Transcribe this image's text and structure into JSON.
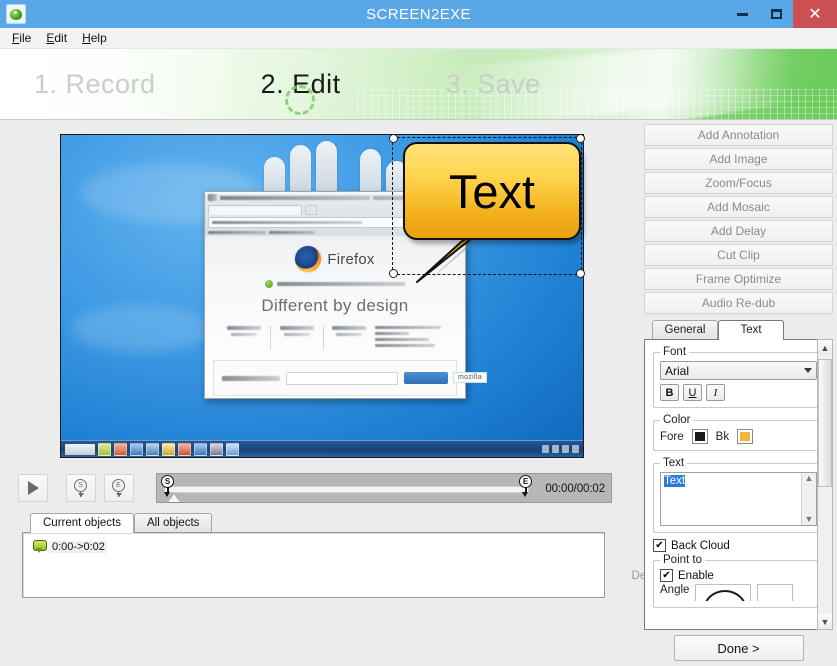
{
  "window": {
    "title": "SCREEN2EXE",
    "app_icon": "green-box-icon",
    "minimize": "minimize-icon",
    "maximize": "maximize-icon",
    "close": "close-icon"
  },
  "menu": {
    "items": [
      {
        "label": "File",
        "mnemonic": "F"
      },
      {
        "label": "Edit",
        "mnemonic": "E"
      },
      {
        "label": "Help",
        "mnemonic": "H"
      }
    ]
  },
  "steps": [
    {
      "label": "1. Record",
      "active": false
    },
    {
      "label": "2. Edit",
      "active": true
    },
    {
      "label": "3. Save",
      "active": false
    }
  ],
  "tools": {
    "buttons": [
      "Add Annotation",
      "Add Image",
      "Zoom/Focus",
      "Add Mosaic",
      "Add Delay",
      "Cut Clip",
      "Frame Optimize",
      "Audio Re-dub"
    ]
  },
  "properties": {
    "tabs": [
      {
        "label": "General",
        "active": false
      },
      {
        "label": "Text",
        "active": true
      }
    ],
    "font": {
      "legend": "Font",
      "family": "Arial",
      "bold": "B",
      "underline": "U",
      "italic": "I"
    },
    "color": {
      "legend": "Color",
      "fore_label": "Fore",
      "fore_value": "#1a1a1a",
      "bk_label": "Bk",
      "bk_value": "#f5b53c"
    },
    "text": {
      "legend": "Text",
      "value": "Text"
    },
    "back_cloud": {
      "label": "Back Cloud",
      "checked": true,
      "mark": "✔"
    },
    "point_to": {
      "legend": "Point to",
      "enable_label": "Enable",
      "enable_checked": true,
      "mark": "✔",
      "angle_label": "Angle"
    }
  },
  "done_button": "Done >",
  "delete_button": "Del.",
  "transport": {
    "play": "play-icon",
    "set_start": "S",
    "set_end": "E",
    "timecode": "00:00/00:02",
    "start_marker": "S",
    "end_marker": "E"
  },
  "objects": {
    "tabs": [
      {
        "label": "Current objects",
        "active": true
      },
      {
        "label": "All objects",
        "active": false
      }
    ],
    "items": [
      {
        "label": "0:00->0:02",
        "icon": "annotation-bubble-icon"
      }
    ]
  },
  "canvas": {
    "annotation": {
      "text": "Text",
      "fill": "#ffd24a",
      "border": "#111111"
    },
    "browser": {
      "name": "Firefox",
      "headline": "Different by design",
      "chip": "mozilla"
    }
  }
}
